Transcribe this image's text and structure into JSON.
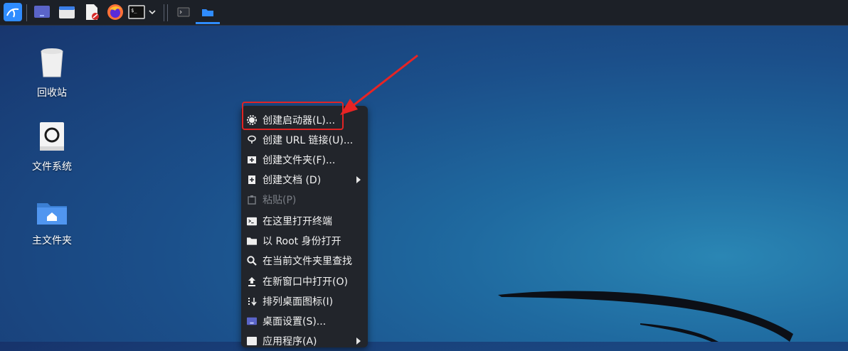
{
  "taskbar": {
    "items": [
      {
        "name": "kali-menu-icon"
      },
      {
        "name": "show-desktop-icon"
      },
      {
        "name": "file-manager-icon"
      },
      {
        "name": "text-editor-icon"
      },
      {
        "name": "firefox-icon"
      },
      {
        "name": "terminal-icon"
      },
      {
        "name": "dropdown-chevron-icon"
      },
      {
        "name": "terminal-window-task-icon"
      },
      {
        "name": "folder-window-task-icon"
      }
    ],
    "terminal_prompt": "$_"
  },
  "desktop": {
    "icons": [
      {
        "label": "回收站",
        "icon": "trash-icon"
      },
      {
        "label": "文件系统",
        "icon": "drive-icon"
      },
      {
        "label": "主文件夹",
        "icon": "home-folder-icon"
      }
    ]
  },
  "context_menu": {
    "items": [
      {
        "label": "创建启动器(L)...",
        "icon": "gear-icon",
        "disabled": false,
        "submenu": false,
        "highlighted": true
      },
      {
        "label": "创建 URL 链接(U)...",
        "icon": "link-icon",
        "disabled": false,
        "submenu": false
      },
      {
        "label": "创建文件夹(F)...",
        "icon": "new-folder-icon",
        "disabled": false,
        "submenu": false
      },
      {
        "label": "创建文档 (D)",
        "icon": "new-document-icon",
        "disabled": false,
        "submenu": true
      },
      {
        "label": "粘贴(P)",
        "icon": "clipboard-icon",
        "disabled": true,
        "submenu": false
      },
      {
        "label": "在这里打开终端",
        "icon": "terminal-icon",
        "disabled": false,
        "submenu": false
      },
      {
        "label": "以 Root 身份打开",
        "icon": "folder-icon",
        "disabled": false,
        "submenu": false
      },
      {
        "label": "在当前文件夹里查找",
        "icon": "search-icon",
        "disabled": false,
        "submenu": false
      },
      {
        "label": "在新窗口中打开(O)",
        "icon": "upload-arrow-icon",
        "disabled": false,
        "submenu": false
      },
      {
        "label": "排列桌面图标(I)",
        "icon": "sort-icon",
        "disabled": false,
        "submenu": false
      },
      {
        "label": "桌面设置(S)...",
        "icon": "desktop-settings-icon",
        "disabled": false,
        "submenu": false
      },
      {
        "label": "应用程序(A)",
        "icon": "applications-icon",
        "disabled": false,
        "submenu": true
      }
    ]
  },
  "colors": {
    "accent": "#2f8cff",
    "highlight_box": "#e02424",
    "arrow": "#e82424"
  }
}
